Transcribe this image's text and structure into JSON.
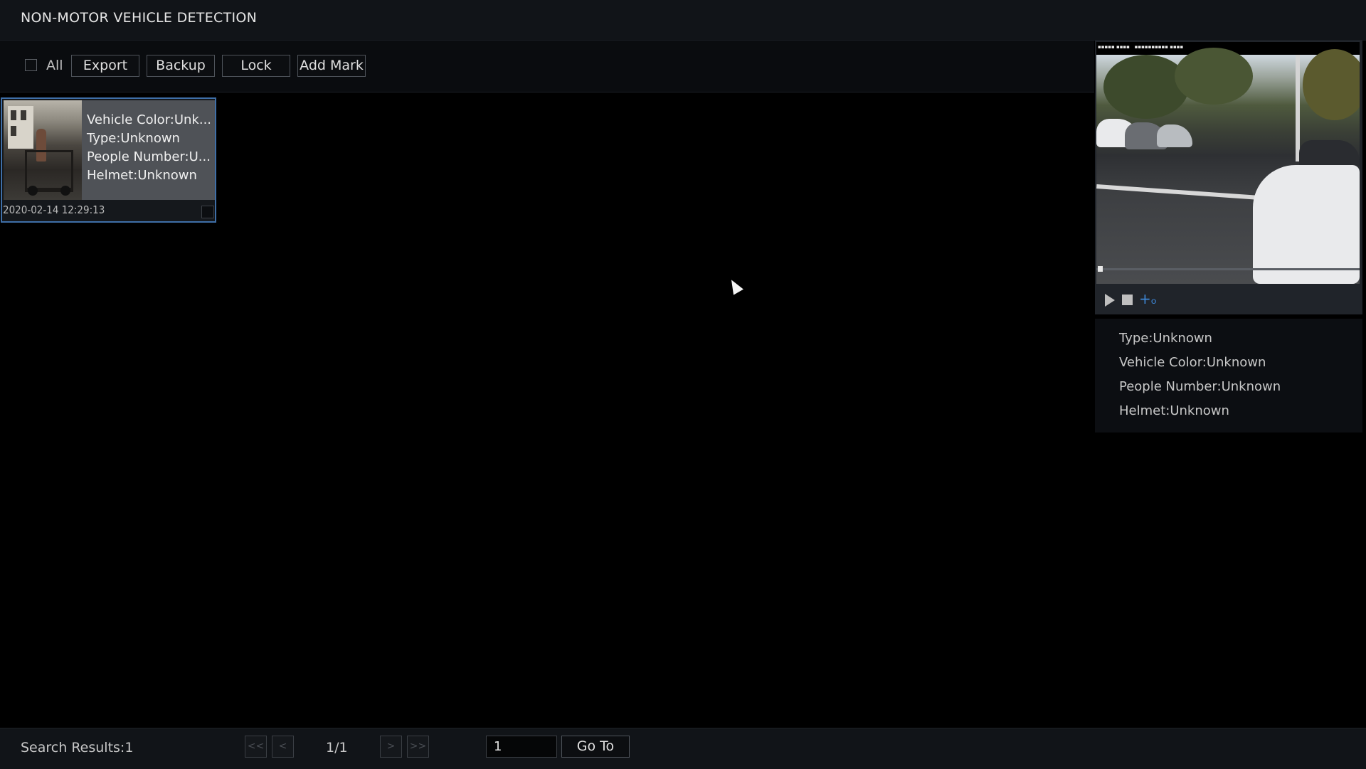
{
  "header": {
    "title": "NON-MOTOR VEHICLE DETECTION"
  },
  "toolbar": {
    "all_label": "All",
    "export_label": "Export",
    "backup_label": "Backup",
    "lock_label": "Lock",
    "add_mark_label": "Add Mark"
  },
  "results": [
    {
      "vehicle_color": "Vehicle Color:Unk...",
      "type": "Type:Unknown",
      "people_number": "People Number:U...",
      "helmet": "Helmet:Unknown",
      "timestamp": "2020-02-14 12:29:13"
    }
  ],
  "preview": {
    "attributes": {
      "type": "Type:Unknown",
      "vehicle_color": "Vehicle Color:Unknown",
      "people_number": "People Number:Unknown",
      "helmet": "Helmet:Unknown"
    },
    "zoom_icon": "+ₒ"
  },
  "footer": {
    "search_results": "Search Results:1",
    "first_label": "<<",
    "prev_label": "<",
    "page_indicator": "1/1",
    "next_label": ">",
    "last_label": ">>",
    "page_input_value": "1",
    "goto_label": "Go To"
  },
  "colors": {
    "accent": "#3f6fa8",
    "zoom_icon": "#3d86d6",
    "background": "#000000"
  }
}
